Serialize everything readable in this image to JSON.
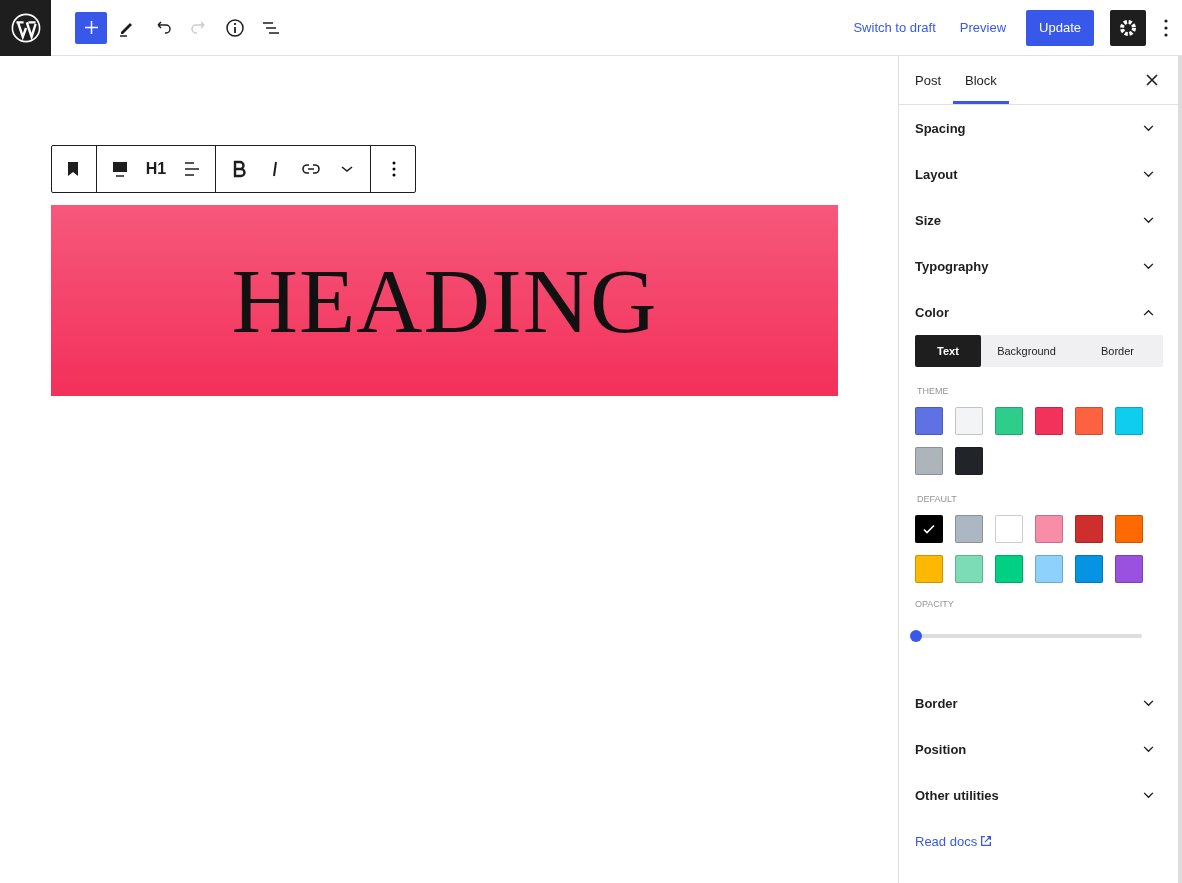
{
  "header": {
    "tools": [
      {
        "kind": "inserter",
        "disabled": false
      },
      {
        "kind": "tools",
        "disabled": false
      },
      {
        "kind": "undo",
        "disabled": false
      },
      {
        "kind": "redo",
        "disabled": true
      },
      {
        "kind": "details",
        "disabled": false
      },
      {
        "kind": "list-view",
        "disabled": false
      }
    ],
    "links": [
      "Switch to draft",
      "Preview"
    ],
    "update_button": "Update",
    "settings_active": true
  },
  "block_toolbar": [
    {
      "kind": "bookmark"
    },
    {
      "kind": "divider"
    },
    {
      "kind": "align-block"
    },
    {
      "kind": "heading",
      "label": "H1"
    },
    {
      "kind": "align-text"
    },
    {
      "kind": "divider"
    },
    {
      "kind": "bold"
    },
    {
      "kind": "italic"
    },
    {
      "kind": "link"
    },
    {
      "kind": "more"
    },
    {
      "kind": "divider"
    },
    {
      "kind": "options"
    }
  ],
  "heading_block": {
    "text": "HEADING"
  },
  "sidebar": {
    "tabs": [
      {
        "label": "Post",
        "selected": false
      },
      {
        "label": "Block",
        "selected": true
      }
    ],
    "sections_before": [
      {
        "title": "Spacing",
        "expanded": false
      },
      {
        "title": "Layout",
        "expanded": false
      },
      {
        "title": "Size",
        "expanded": false
      },
      {
        "title": "Typography",
        "expanded": false
      }
    ],
    "color": {
      "title": "Color",
      "expanded": true,
      "segments": [
        {
          "label": "Text",
          "selected": true
        },
        {
          "label": "Background",
          "selected": false
        },
        {
          "label": "Border",
          "selected": false
        }
      ],
      "palettes": [
        {
          "label": "THEME",
          "swatches": [
            {
              "color": "#5f72e3",
              "selected": false
            },
            {
              "color": "#f3f4f5",
              "selected": false
            },
            {
              "color": "#2ecd8b",
              "selected": false
            },
            {
              "color": "#f3325b",
              "selected": false
            },
            {
              "color": "#fd6240",
              "selected": false
            },
            {
              "color": "#0fcdee",
              "selected": false
            },
            {
              "color": "#adb4ba",
              "selected": false
            },
            {
              "color": "#212529",
              "selected": false
            }
          ]
        },
        {
          "label": "DEFAULT",
          "swatches": [
            {
              "color": "#000000",
              "selected": true
            },
            {
              "color": "#abb8c3",
              "selected": false
            },
            {
              "color": "#ffffff",
              "selected": false
            },
            {
              "color": "#f78da7",
              "selected": false
            },
            {
              "color": "#cf2e2e",
              "selected": false
            },
            {
              "color": "#ff6900",
              "selected": false
            },
            {
              "color": "#fcb900",
              "selected": false
            },
            {
              "color": "#7bdcb5",
              "selected": false
            },
            {
              "color": "#00d084",
              "selected": false
            },
            {
              "color": "#8ed1fc",
              "selected": false
            },
            {
              "color": "#0693e3",
              "selected": false
            },
            {
              "color": "#9b51e0",
              "selected": false
            }
          ]
        }
      ],
      "opacity": {
        "label": "OPACITY",
        "level": 0
      }
    },
    "sections_after": [
      {
        "title": "Border",
        "expanded": false
      },
      {
        "title": "Position",
        "expanded": false
      },
      {
        "title": "Other utilities",
        "expanded": false
      }
    ],
    "read_docs": "Read docs"
  }
}
